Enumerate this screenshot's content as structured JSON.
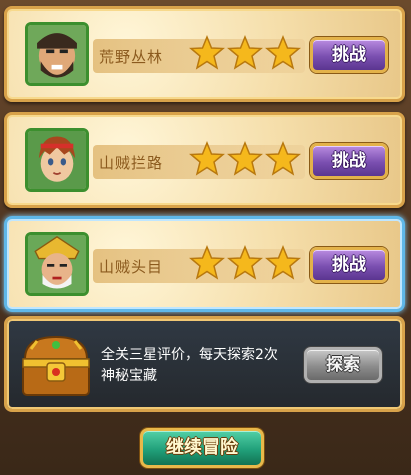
{
  "stages": [
    {
      "name": "荒野丛林",
      "stars": 3,
      "selected": false,
      "action_label": "挑战",
      "avatar": "bearded-warrior-portrait"
    },
    {
      "name": "山贼拦路",
      "stars": 3,
      "selected": false,
      "action_label": "挑战",
      "avatar": "young-warrior-portrait"
    },
    {
      "name": "山贼头目",
      "stars": 3,
      "selected": true,
      "action_label": "挑战",
      "avatar": "armored-general-portrait"
    }
  ],
  "treasure": {
    "text": "全关三星评价，每天探索2次神秘宝藏",
    "action_label": "探索",
    "icon": "treasure-chest"
  },
  "continue_label": "继续冒险",
  "colors": {
    "card_border": "#d8a24a",
    "selected_border": "#5fb7e8",
    "challenge_button": "#7a4fb0",
    "explore_button": "#8c8c8c",
    "continue_button": "#21a07a",
    "star": "#f5b81c"
  }
}
